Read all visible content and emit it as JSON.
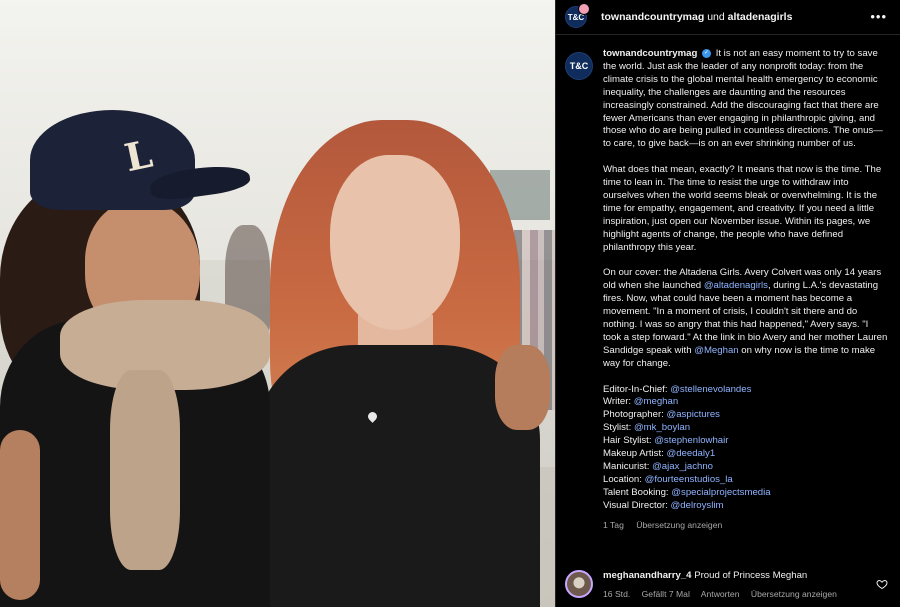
{
  "header": {
    "account1": "townandcountrymag",
    "connector": "und",
    "account2": "altadenagirls",
    "avatar_text": "T&C",
    "more_icon": "ellipsis-icon"
  },
  "photo": {
    "cap_letter": "L"
  },
  "caption": {
    "avatar_text": "T&C",
    "username": "townandcountrymag",
    "verified_icon": "verified-badge-icon",
    "p1": "It is not an easy moment to try to save the world. Just ask the leader of any nonprofit today: from the climate crisis to the global mental health emergency to economic inequality, the challenges are daunting and the resources increasingly constrained. Add the discouraging fact that there are fewer Americans than ever engaging in philanthropic giving, and those who do are being pulled in countless directions. The onus—to care, to give back—is on an ever shrinking number of us.",
    "p2": "What does that mean, exactly? It means that now is the time. The time to lean in. The time to resist the urge to withdraw into ourselves when the world seems bleak or overwhelming. It is the time for empathy, engagement, and creativity. If you need a little inspiration, just open our November issue. Within its pages, we highlight agents of change, the people who have defined philanthropy this year.",
    "p3_a": "On our cover: the Altadena Girls. Avery Colvert was only 14 years old when she launched ",
    "p3_mention1": "@altadenagirls",
    "p3_b": ", during L.A.'s devastating fires. Now, what could have been a moment has become a movement. \"In a moment of crisis, I couldn't sit there and do nothing. I was so angry that this had happened,\" Avery says. \"I took a step forward.\" At the link in bio Avery and her mother Lauren Sandidge speak with ",
    "p3_mention2": "@Meghan",
    "p3_c": " on why now is the time to make way for change.",
    "credits": [
      {
        "role": "Editor-In-Chief:",
        "handle": "@stellenevolandes"
      },
      {
        "role": "Writer:",
        "handle": "@meghan"
      },
      {
        "role": "Photographer:",
        "handle": "@aspictures"
      },
      {
        "role": "Stylist:",
        "handle": "@mk_boylan"
      },
      {
        "role": "Hair Stylist:",
        "handle": "@stephenlowhair"
      },
      {
        "role": "Makeup Artist:",
        "handle": "@deedaly1"
      },
      {
        "role": "Manicurist:",
        "handle": "@ajax_jachno"
      },
      {
        "role": "Location:",
        "handle": "@fourteenstudios_la"
      },
      {
        "role": "Talent Booking:",
        "handle": "@specialprojectsmedia"
      },
      {
        "role": "Visual Director:",
        "handle": "@delroyslim"
      }
    ],
    "time": "1 Tag",
    "translate": "Übersetzung anzeigen"
  },
  "comment": {
    "username": "meghanandharry_4",
    "text": "Proud of Princess Meghan",
    "time": "16 Std.",
    "likes": "Gefällt 7 Mal",
    "reply": "Antworten",
    "translate": "Übersetzung anzeigen",
    "like_icon": "heart-icon"
  },
  "colors": {
    "background": "#000000",
    "mention": "#8fb4ff",
    "muted": "#a8a8a8",
    "verified": "#3a97ef",
    "brand_avatar": "#0f2c5c"
  }
}
